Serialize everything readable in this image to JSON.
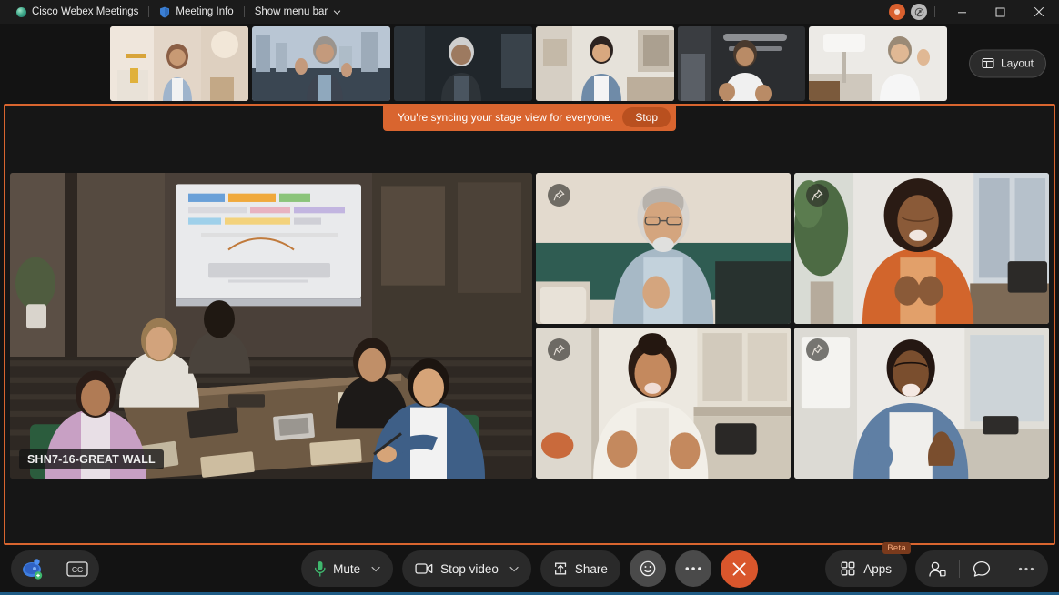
{
  "app": {
    "title": "Cisco Webex Meetings",
    "meeting_info_label": "Meeting Info",
    "menu_bar_label": "Show menu bar"
  },
  "titlebar": {
    "record_icon": "record-icon",
    "network_icon": "network-quality-icon",
    "minimize": "—",
    "maximize": "☐",
    "close": "✕"
  },
  "filmstrip": {
    "layout_button": "Layout",
    "thumbnails": [
      {
        "name": "participant-thumbnail-1"
      },
      {
        "name": "participant-thumbnail-2"
      },
      {
        "name": "participant-thumbnail-3"
      },
      {
        "name": "participant-thumbnail-4"
      },
      {
        "name": "participant-thumbnail-5"
      },
      {
        "name": "participant-thumbnail-6"
      }
    ]
  },
  "stage": {
    "sync_banner": {
      "message": "You're syncing your stage view for everyone.",
      "stop_label": "Stop"
    },
    "main_video_label": "SHN7-16-GREAT WALL",
    "tiles": [
      {
        "name": "stage-tile-room",
        "pin": false
      },
      {
        "name": "stage-tile-2",
        "pin": true
      },
      {
        "name": "stage-tile-3",
        "pin": true
      },
      {
        "name": "stage-tile-4",
        "pin": true
      },
      {
        "name": "stage-tile-5",
        "pin": true
      }
    ]
  },
  "toolbar": {
    "assistant_label": "webex-assistant",
    "captions_label": "CC",
    "mute_label": "Mute",
    "video_label": "Stop video",
    "share_label": "Share",
    "reactions_label": "reactions",
    "more_label": "more-options",
    "leave_label": "✕",
    "apps_label": "Apps",
    "apps_badge": "Beta",
    "participants_label": "participants",
    "chat_label": "chat",
    "right_more_label": "more"
  },
  "colors": {
    "accent_orange": "#d9652f",
    "leave_red": "#d9562c",
    "bar_dark": "#131313",
    "pill": "#2a2a2a",
    "blue_strip": "#1f5c86"
  }
}
